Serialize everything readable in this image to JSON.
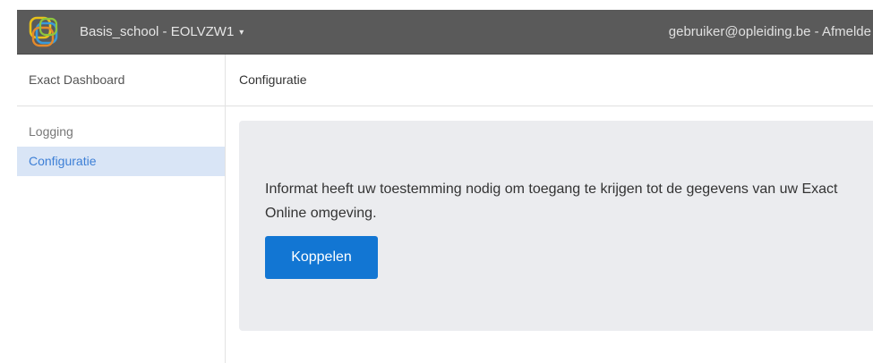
{
  "topbar": {
    "school_name": "Basis_school - EOLVZW1",
    "caret": "▾",
    "user_email": "gebruiker@opleiding.be",
    "separator": " - ",
    "logout_label": "Afmelde"
  },
  "sidebar": {
    "header": "Exact Dashboard",
    "items": [
      {
        "label": "Logging"
      },
      {
        "label": "Configuratie"
      }
    ]
  },
  "main": {
    "page_title": "Configuratie",
    "message": "Informat heeft uw toestemming nodig om toegang te krijgen tot de gegevens van uw Exact Online omgeving.",
    "connect_button": "Koppelen"
  },
  "colors": {
    "topbar": "#5a5a5a",
    "accent": "#1276d3",
    "active_nav_bg": "#d9e5f6",
    "panel_bg": "#ebecef"
  }
}
